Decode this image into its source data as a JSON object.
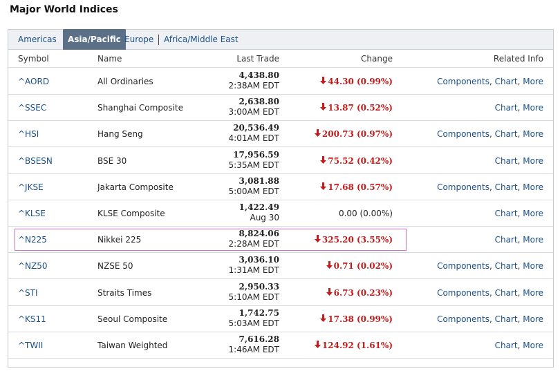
{
  "page_title": "Major World Indices",
  "tabs": [
    {
      "label": "Americas"
    },
    {
      "label": "Asia/Pacific"
    },
    {
      "label": "Europe"
    },
    {
      "label": "Africa/Middle East"
    }
  ],
  "columns": {
    "symbol": "Symbol",
    "name": "Name",
    "last_trade": "Last Trade",
    "change": "Change",
    "related": "Related Info"
  },
  "related_labels": {
    "components": "Components",
    "chart": "Chart",
    "more": "More",
    "separator": ", "
  },
  "colors": {
    "link": "#1a4f86",
    "down": "#c41a1a",
    "active_tab": "#5b6f86",
    "highlight_box": "#d46bd8"
  },
  "icons": {
    "down_arrow": "down-arrow-icon"
  },
  "rows": [
    {
      "symbol": "^AORD",
      "name": "All Ordinaries",
      "price": "4,438.80",
      "time": "2:38AM EDT",
      "change": "44.30 (0.99%)",
      "direction": "down",
      "components": true
    },
    {
      "symbol": "^SSEC",
      "name": "Shanghai Composite",
      "price": "2,638.80",
      "time": "3:00AM EDT",
      "change": "13.87 (0.52%)",
      "direction": "down",
      "components": false
    },
    {
      "symbol": "^HSI",
      "name": "Hang Seng",
      "price": "20,536.49",
      "time": "4:01AM EDT",
      "change": "200.73 (0.97%)",
      "direction": "down",
      "components": true
    },
    {
      "symbol": "^BSESN",
      "name": "BSE 30",
      "price": "17,956.59",
      "time": "5:35AM EDT",
      "change": "75.52 (0.42%)",
      "direction": "down",
      "components": false
    },
    {
      "symbol": "^JKSE",
      "name": "Jakarta Composite",
      "price": "3,081.88",
      "time": "5:00AM EDT",
      "change": "17.68 (0.57%)",
      "direction": "down",
      "components": true
    },
    {
      "symbol": "^KLSE",
      "name": "KLSE Composite",
      "price": "1,422.49",
      "time": "Aug 30",
      "change": "0.00 (0.00%)",
      "direction": "flat",
      "components": false
    },
    {
      "symbol": "^N225",
      "name": "Nikkei 225",
      "price": "8,824.06",
      "time": "2:28AM EDT",
      "change": "325.20 (3.55%)",
      "direction": "down",
      "components": false,
      "highlighted": true
    },
    {
      "symbol": "^NZ50",
      "name": "NZSE 50",
      "price": "3,036.10",
      "time": "1:31AM EDT",
      "change": "0.71 (0.02%)",
      "direction": "down",
      "components": true
    },
    {
      "symbol": "^STI",
      "name": "Straits Times",
      "price": "2,950.33",
      "time": "5:10AM EDT",
      "change": "6.73 (0.23%)",
      "direction": "down",
      "components": true
    },
    {
      "symbol": "^KS11",
      "name": "Seoul Composite",
      "price": "1,742.75",
      "time": "5:03AM EDT",
      "change": "17.38 (0.99%)",
      "direction": "down",
      "components": true
    },
    {
      "symbol": "^TWII",
      "name": "Taiwan Weighted",
      "price": "7,616.28",
      "time": "1:46AM EDT",
      "change": "124.92 (1.61%)",
      "direction": "down",
      "components": false
    }
  ]
}
